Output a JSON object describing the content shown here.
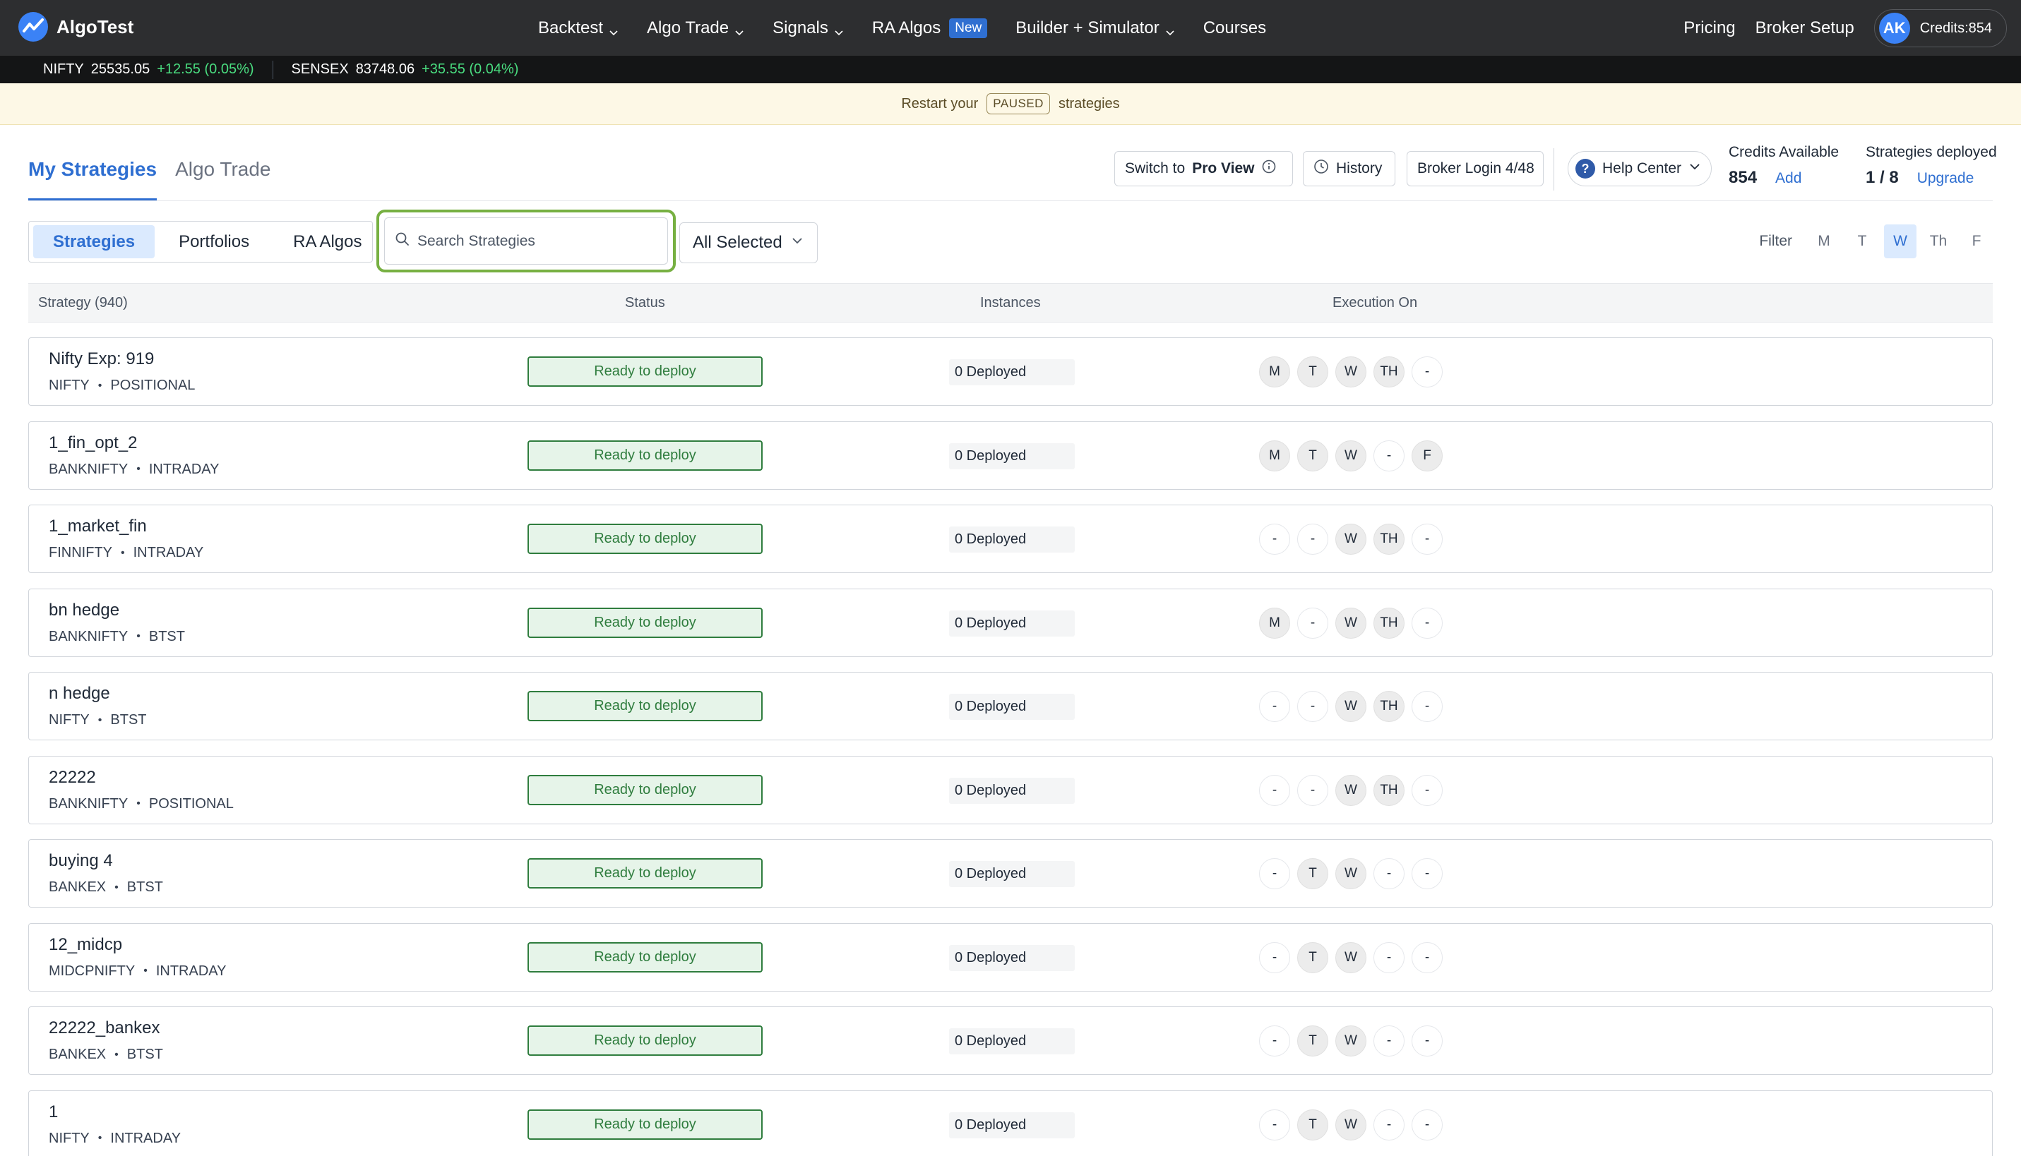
{
  "brand": {
    "name": "AlgoTest"
  },
  "nav": {
    "items": [
      {
        "label": "Backtest",
        "has_dropdown": true
      },
      {
        "label": "Algo Trade",
        "has_dropdown": true
      },
      {
        "label": "Signals",
        "has_dropdown": true
      },
      {
        "label": "RA Algos",
        "badge": "New",
        "has_dropdown": false
      },
      {
        "label": "Builder + Simulator",
        "has_dropdown": true
      },
      {
        "label": "Courses",
        "has_dropdown": false
      }
    ],
    "pricing": "Pricing",
    "broker_setup": "Broker Setup",
    "avatar_initials": "AK",
    "credits": "Credits:854"
  },
  "ticker": [
    {
      "symbol": "NIFTY",
      "value": "25535.05",
      "change": "+12.55 (0.05%)"
    },
    {
      "symbol": "SENSEX",
      "value": "83748.06",
      "change": "+35.55 (0.04%)"
    }
  ],
  "banner": {
    "prefix": "Restart your",
    "tag": "PAUSED",
    "suffix": "strategies"
  },
  "header": {
    "tabs": [
      {
        "label": "My Strategies",
        "active": true
      },
      {
        "label": "Algo Trade",
        "active": false
      }
    ],
    "switch_prefix": "Switch to",
    "switch_target": "Pro View",
    "history": "History",
    "broker_login": "Broker Login 4/48",
    "help_center": "Help Center",
    "credits_label": "Credits Available",
    "credits_value": "854",
    "credits_link": "Add",
    "deployed_label": "Strategies deployed",
    "deployed_value": "1 / 8",
    "deployed_link": "Upgrade"
  },
  "filters": {
    "segments": [
      {
        "label": "Strategies",
        "active": true
      },
      {
        "label": "Portfolios",
        "active": false
      },
      {
        "label": "RA Algos",
        "active": false
      }
    ],
    "search_placeholder": "Search Strategies",
    "dropdown_value": "All Selected",
    "day_filter_label": "Filter",
    "days": [
      {
        "label": "M",
        "active": false
      },
      {
        "label": "T",
        "active": false
      },
      {
        "label": "W",
        "active": true
      },
      {
        "label": "Th",
        "active": false
      },
      {
        "label": "F",
        "active": false
      }
    ]
  },
  "table": {
    "headers": {
      "strategy": "Strategy (940)",
      "status": "Status",
      "instances": "Instances",
      "execution": "Execution On"
    },
    "rows": [
      {
        "name": "Nifty Exp: 919",
        "underlying": "NIFTY",
        "type": "POSITIONAL",
        "status": "Ready to deploy",
        "instances": "0 Deployed",
        "days": [
          {
            "l": "M",
            "on": true
          },
          {
            "l": "T",
            "on": true
          },
          {
            "l": "W",
            "on": true
          },
          {
            "l": "TH",
            "on": true
          },
          {
            "l": "-",
            "on": false
          }
        ]
      },
      {
        "name": "1_fin_opt_2",
        "underlying": "BANKNIFTY",
        "type": "INTRADAY",
        "status": "Ready to deploy",
        "instances": "0 Deployed",
        "days": [
          {
            "l": "M",
            "on": true
          },
          {
            "l": "T",
            "on": true
          },
          {
            "l": "W",
            "on": true
          },
          {
            "l": "-",
            "on": false
          },
          {
            "l": "F",
            "on": true
          }
        ]
      },
      {
        "name": "1_market_fin",
        "underlying": "FINNIFTY",
        "type": "INTRADAY",
        "status": "Ready to deploy",
        "instances": "0 Deployed",
        "days": [
          {
            "l": "-",
            "on": false
          },
          {
            "l": "-",
            "on": false
          },
          {
            "l": "W",
            "on": true
          },
          {
            "l": "TH",
            "on": true
          },
          {
            "l": "-",
            "on": false
          }
        ]
      },
      {
        "name": "bn hedge",
        "underlying": "BANKNIFTY",
        "type": "BTST",
        "status": "Ready to deploy",
        "instances": "0 Deployed",
        "days": [
          {
            "l": "M",
            "on": true
          },
          {
            "l": "-",
            "on": false
          },
          {
            "l": "W",
            "on": true
          },
          {
            "l": "TH",
            "on": true
          },
          {
            "l": "-",
            "on": false
          }
        ]
      },
      {
        "name": "n hedge",
        "underlying": "NIFTY",
        "type": "BTST",
        "status": "Ready to deploy",
        "instances": "0 Deployed",
        "days": [
          {
            "l": "-",
            "on": false
          },
          {
            "l": "-",
            "on": false
          },
          {
            "l": "W",
            "on": true
          },
          {
            "l": "TH",
            "on": true
          },
          {
            "l": "-",
            "on": false
          }
        ]
      },
      {
        "name": "22222",
        "underlying": "BANKNIFTY",
        "type": "POSITIONAL",
        "status": "Ready to deploy",
        "instances": "0 Deployed",
        "days": [
          {
            "l": "-",
            "on": false
          },
          {
            "l": "-",
            "on": false
          },
          {
            "l": "W",
            "on": true
          },
          {
            "l": "TH",
            "on": true
          },
          {
            "l": "-",
            "on": false
          }
        ]
      },
      {
        "name": "buying 4",
        "underlying": "BANKEX",
        "type": "BTST",
        "status": "Ready to deploy",
        "instances": "0 Deployed",
        "days": [
          {
            "l": "-",
            "on": false
          },
          {
            "l": "T",
            "on": true
          },
          {
            "l": "W",
            "on": true
          },
          {
            "l": "-",
            "on": false
          },
          {
            "l": "-",
            "on": false
          }
        ]
      },
      {
        "name": "12_midcp",
        "underlying": "MIDCPNIFTY",
        "type": "INTRADAY",
        "status": "Ready to deploy",
        "instances": "0 Deployed",
        "days": [
          {
            "l": "-",
            "on": false
          },
          {
            "l": "T",
            "on": true
          },
          {
            "l": "W",
            "on": true
          },
          {
            "l": "-",
            "on": false
          },
          {
            "l": "-",
            "on": false
          }
        ]
      },
      {
        "name": "22222_bankex",
        "underlying": "BANKEX",
        "type": "BTST",
        "status": "Ready to deploy",
        "instances": "0 Deployed",
        "days": [
          {
            "l": "-",
            "on": false
          },
          {
            "l": "T",
            "on": true
          },
          {
            "l": "W",
            "on": true
          },
          {
            "l": "-",
            "on": false
          },
          {
            "l": "-",
            "on": false
          }
        ]
      },
      {
        "name": "1",
        "underlying": "NIFTY",
        "type": "INTRADAY",
        "status": "Ready to deploy",
        "instances": "0 Deployed",
        "days": [
          {
            "l": "-",
            "on": false
          },
          {
            "l": "T",
            "on": true
          },
          {
            "l": "W",
            "on": true
          },
          {
            "l": "-",
            "on": false
          },
          {
            "l": "-",
            "on": false
          }
        ]
      }
    ]
  },
  "colors": {
    "accent": "#2f6fd1",
    "nav_bg": "#2d2e30",
    "ready_green": "#2f7d3e",
    "search_highlight": "#77b042"
  }
}
